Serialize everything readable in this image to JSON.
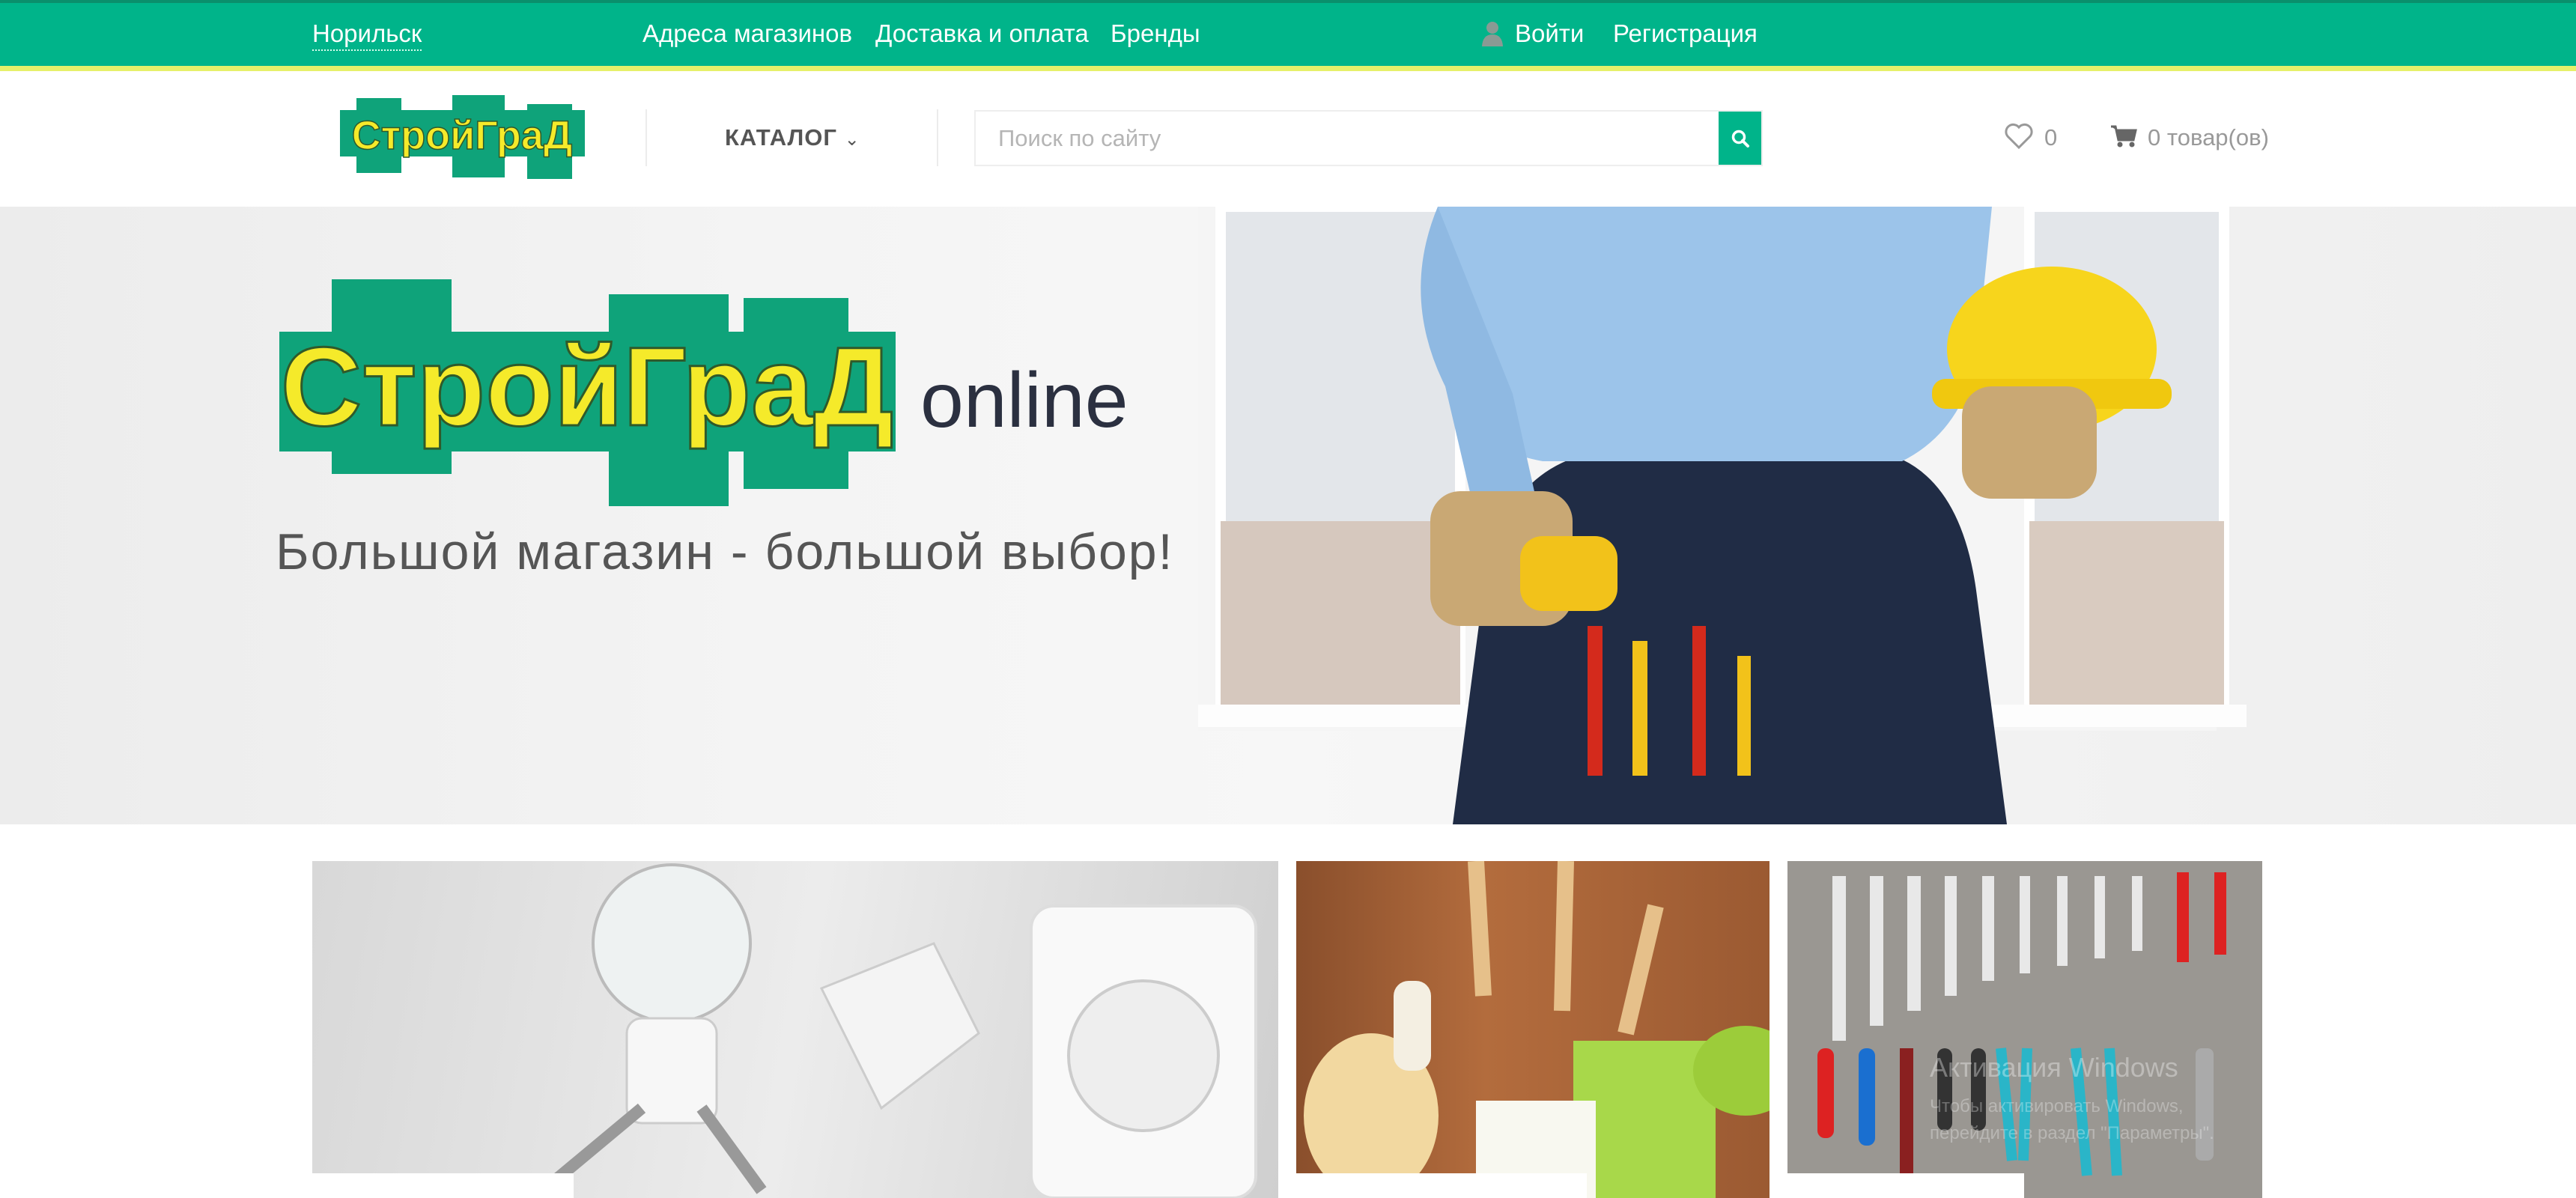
{
  "topbar": {
    "city": "Норильск",
    "links": [
      "Адреса магазинов",
      "Доставка и оплата",
      "Бренды"
    ],
    "login": "Войти",
    "register": "Регистрация"
  },
  "header": {
    "logo_text": "СтройГраД",
    "catalog": "КАТАЛОГ",
    "search_placeholder": "Поиск по сайту",
    "wishlist_count": "0",
    "cart": "0 товар(ов)"
  },
  "hero": {
    "logo_text": "СтройГраД",
    "logo_suffix": "online",
    "tagline": "Большой магазин - большой выбор!"
  },
  "tiles": [
    "electrics",
    "kitchenware",
    "tools"
  ],
  "watermark": {
    "line1": "Активация Windows",
    "line2": "Чтобы активировать Windows, перейдите в раздел \"Параметры\"."
  },
  "colors": {
    "brand_green": "#00b48a",
    "accent_yellow": "#e6f06a",
    "logo_yellow": "#f5ea2a"
  }
}
